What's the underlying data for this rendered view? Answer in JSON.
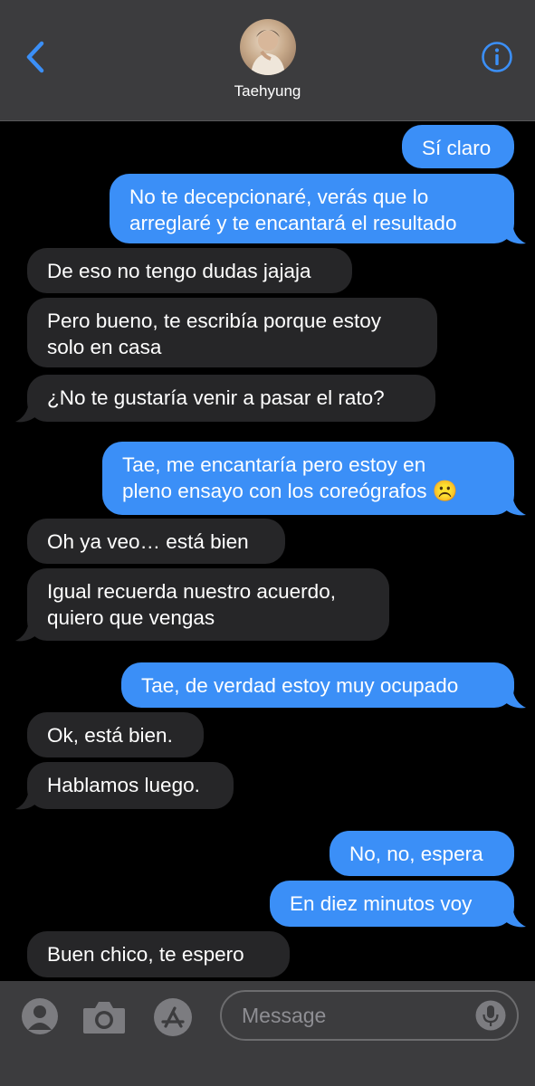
{
  "header": {
    "contact_name": "Taehyung",
    "back_icon": "chevron-left-icon",
    "info_icon": "info-circle-icon",
    "accent_color": "#3b8ff7"
  },
  "messages": [
    {
      "dir": "out",
      "text": "Sí claro"
    },
    {
      "dir": "out",
      "text": "No te decepcionaré, verás que lo\narreglaré y te encantará el resultado"
    },
    {
      "dir": "in",
      "text": "De eso no tengo dudas jajaja"
    },
    {
      "dir": "in",
      "text": "Pero bueno, te escribía porque estoy\nsolo en casa"
    },
    {
      "dir": "in",
      "text": "¿No te gustaría venir a pasar el rato?"
    },
    {
      "dir": "out",
      "text": "Tae, me encantaría pero estoy en\npleno ensayo con los coreógrafos ☹️"
    },
    {
      "dir": "in",
      "text": "Oh ya veo… está bien"
    },
    {
      "dir": "in",
      "text": "Igual recuerda nuestro acuerdo,\nquiero que vengas"
    },
    {
      "dir": "out",
      "text": "Tae, de verdad estoy muy ocupado"
    },
    {
      "dir": "in",
      "text": "Ok, está bien."
    },
    {
      "dir": "in",
      "text": "Hablamos luego."
    },
    {
      "dir": "out",
      "text": "No, no, espera"
    },
    {
      "dir": "out",
      "text": "En diez minutos voy"
    },
    {
      "dir": "in",
      "text": "Buen chico, te espero"
    }
  ],
  "composer": {
    "placeholder": "Message",
    "icons": [
      "memoji-icon",
      "camera-icon",
      "app-store-icon",
      "microphone-icon"
    ]
  },
  "colors": {
    "incoming_bubble": "#262628",
    "outgoing_bubble": "#3b8ff7",
    "background": "#000000",
    "bars": "#3c3c3e"
  }
}
